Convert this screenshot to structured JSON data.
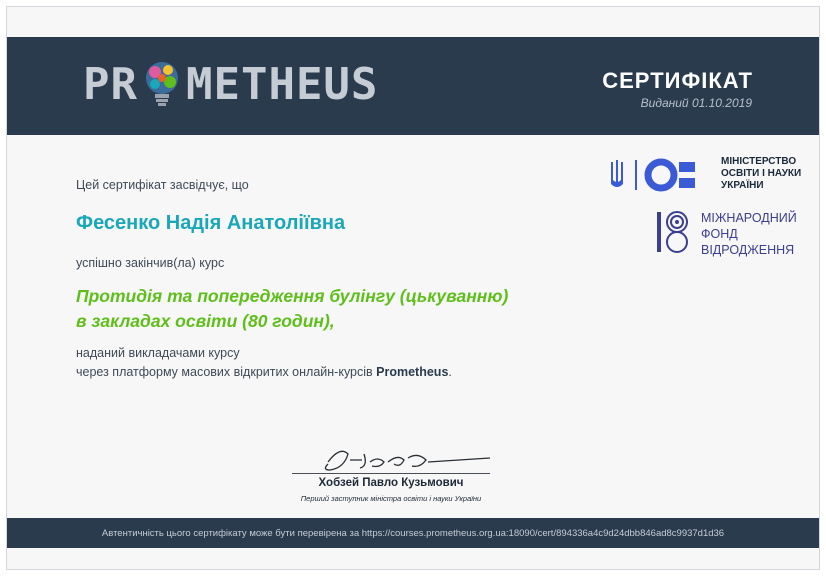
{
  "header": {
    "logo_left": "PR",
    "logo_right": "METHEUS",
    "title": "СЕРТИФІКАТ",
    "issued": "Виданий 01.10.2019"
  },
  "body": {
    "intro": "Цей сертифікат засвідчує, що",
    "recipient": "Фесенко Надія Анатоліївна",
    "completed": "успішно закінчив(ла) курс",
    "course_line1": "Протидія та попередження булінгу (цькуванню)",
    "course_line2": "в закладах освіти (80 годин),",
    "provided_line1": "наданий викладачами курсу",
    "provided_line2_prefix": "через платформу масових відкритих онлайн-курсів ",
    "provided_line2_bold": "Prometheus",
    "provided_line2_suffix": "."
  },
  "partners": {
    "mon_line1": "МІНІСТЕРСТВО",
    "mon_line2": "ОСВІТИ І НАУКИ",
    "mon_line3": "УКРАЇНИ",
    "irf_line1": "МІЖНАРОДНИЙ",
    "irf_line2": "ФОНД",
    "irf_line3": "ВІДРОДЖЕННЯ"
  },
  "signature": {
    "name": "Хобзей Павло Кузьмович",
    "position": "Перший заступник міністра освіти і науки України"
  },
  "footer": {
    "verify_text": "Автентичність цього сертифікату може бути перевірена за https://courses.prometheus.org.ua:18090/cert/894336a4c9d24dbb846ad8c9937d1d36"
  },
  "colors": {
    "header_bg": "#2a3b4e",
    "recipient": "#1aa7b9",
    "course": "#5fbf1a"
  }
}
